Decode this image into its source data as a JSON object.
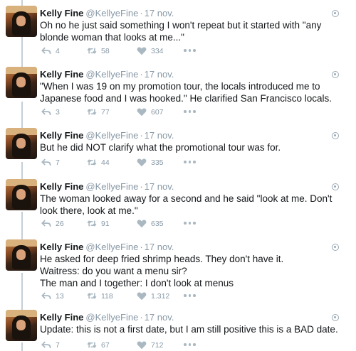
{
  "tweets": [
    {
      "name": "Kelly Fine",
      "handle": "@KellyeFine",
      "time": "17 nov.",
      "text": "Oh no he just said something I won't repeat but it started with \"any blonde woman that looks at me...\"",
      "replies": "4",
      "retweets": "58",
      "likes": "334"
    },
    {
      "name": "Kelly Fine",
      "handle": "@KellyeFine",
      "time": "17 nov.",
      "text": "\"When I was 19 on my promotion tour, the locals introduced me to Japanese food and I was hooked.\" He clarified San Francisco locals.",
      "replies": "3",
      "retweets": "77",
      "likes": "607"
    },
    {
      "name": "Kelly Fine",
      "handle": "@KellyeFine",
      "time": "17 nov.",
      "text": "But he did NOT clarify what the promotional tour was for.",
      "replies": "7",
      "retweets": "44",
      "likes": "335"
    },
    {
      "name": "Kelly Fine",
      "handle": "@KellyeFine",
      "time": "17 nov.",
      "text": "The woman looked away for a second and he said \"look at me. Don't look there, look at me.\"",
      "replies": "26",
      "retweets": "91",
      "likes": "635"
    },
    {
      "name": "Kelly Fine",
      "handle": "@KellyeFine",
      "time": "17 nov.",
      "text_lines": [
        "He asked for deep fried shrimp heads. They don't have it.",
        "Waitress: do you want a menu sir?",
        "The man and I together: I don't look at menus"
      ],
      "replies": "13",
      "retweets": "118",
      "likes": "1.312"
    },
    {
      "name": "Kelly Fine",
      "handle": "@KellyeFine",
      "time": "17 nov.",
      "text": "Update: this is not a first date, but I am still positive this is a BAD date.",
      "replies": "7",
      "retweets": "67",
      "likes": "712"
    }
  ],
  "icons": {
    "reply": "reply-icon",
    "retweet": "retweet-icon",
    "like": "heart-icon",
    "more": "more-dots-icon",
    "menu": "caret-menu-icon"
  },
  "colors": {
    "text": "#14171a",
    "secondary": "#8899a6",
    "icon": "#aab8c2",
    "thread_line": "#c4cfd6"
  }
}
